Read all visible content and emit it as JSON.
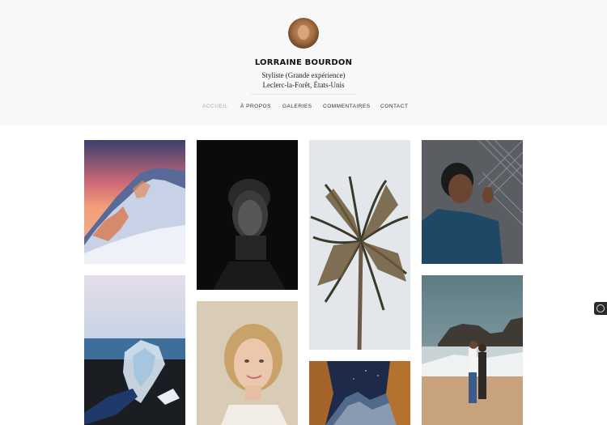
{
  "profile": {
    "name": "LORRAINE BOURDON",
    "title": "Styliste (Grande expérience)",
    "location": "Leclerc-la-Forêt, États-Unis",
    "avatar_icon": "profile-photo"
  },
  "nav": {
    "items": [
      "ACCUEIL",
      "À PROPOS",
      "GALERIES",
      "COMMENTAIRES",
      "CONTACT"
    ],
    "active": "ACCUEIL"
  },
  "gallery": {
    "photos": [
      "mountain-sunset-photo",
      "portrait-dark-man-photo",
      "palm-tree-photo",
      "man-fence-photo",
      "ice-hand-photo",
      "blonde-woman-photo",
      "night-mountains-photo",
      "beach-couple-photo"
    ]
  },
  "widget": {
    "icon": "theme-toggle-icon"
  }
}
